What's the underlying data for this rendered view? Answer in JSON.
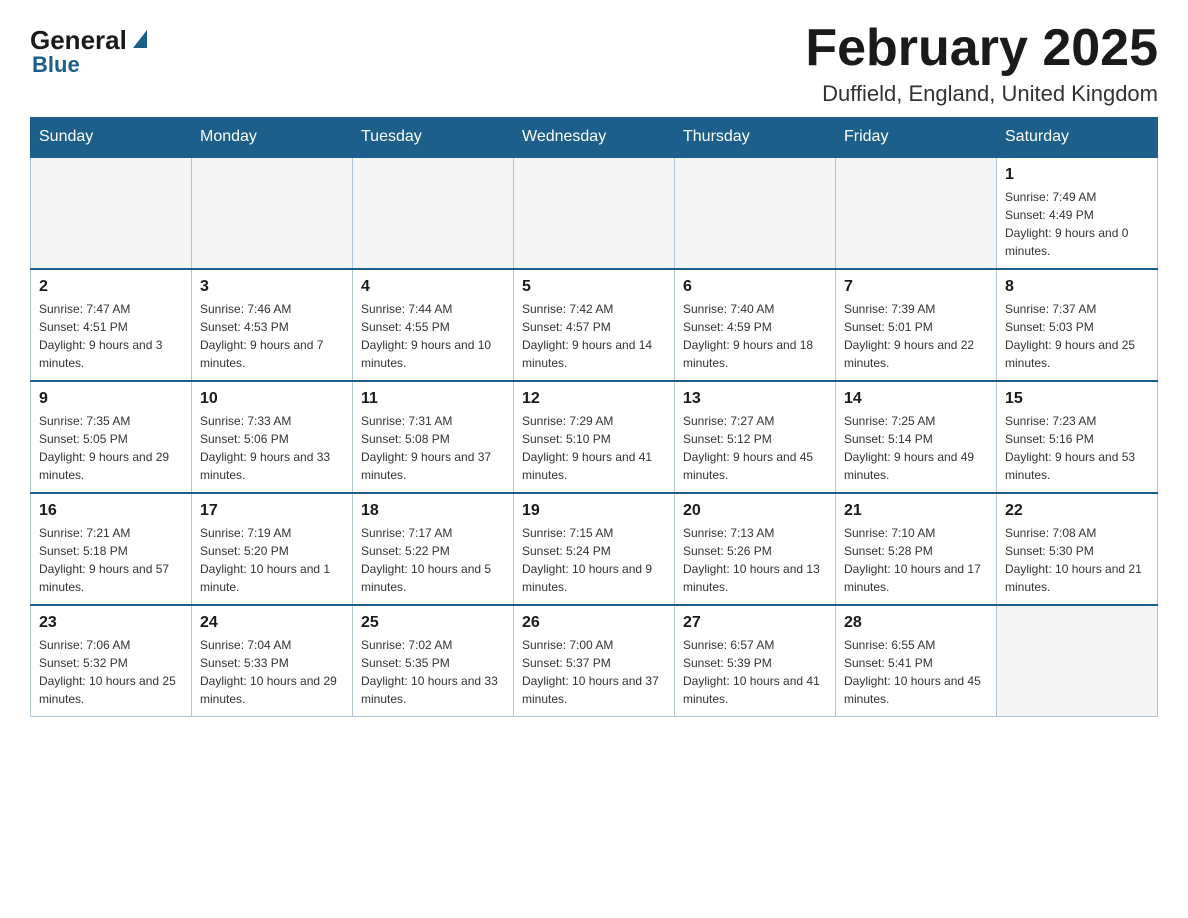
{
  "header": {
    "logo_general": "General",
    "logo_blue": "Blue",
    "month_title": "February 2025",
    "location": "Duffield, England, United Kingdom"
  },
  "days_of_week": [
    "Sunday",
    "Monday",
    "Tuesday",
    "Wednesday",
    "Thursday",
    "Friday",
    "Saturday"
  ],
  "weeks": [
    [
      {
        "num": "",
        "sunrise": "",
        "sunset": "",
        "daylight": "",
        "empty": true
      },
      {
        "num": "",
        "sunrise": "",
        "sunset": "",
        "daylight": "",
        "empty": true
      },
      {
        "num": "",
        "sunrise": "",
        "sunset": "",
        "daylight": "",
        "empty": true
      },
      {
        "num": "",
        "sunrise": "",
        "sunset": "",
        "daylight": "",
        "empty": true
      },
      {
        "num": "",
        "sunrise": "",
        "sunset": "",
        "daylight": "",
        "empty": true
      },
      {
        "num": "",
        "sunrise": "",
        "sunset": "",
        "daylight": "",
        "empty": true
      },
      {
        "num": "1",
        "sunrise": "Sunrise: 7:49 AM",
        "sunset": "Sunset: 4:49 PM",
        "daylight": "Daylight: 9 hours and 0 minutes.",
        "empty": false
      }
    ],
    [
      {
        "num": "2",
        "sunrise": "Sunrise: 7:47 AM",
        "sunset": "Sunset: 4:51 PM",
        "daylight": "Daylight: 9 hours and 3 minutes.",
        "empty": false
      },
      {
        "num": "3",
        "sunrise": "Sunrise: 7:46 AM",
        "sunset": "Sunset: 4:53 PM",
        "daylight": "Daylight: 9 hours and 7 minutes.",
        "empty": false
      },
      {
        "num": "4",
        "sunrise": "Sunrise: 7:44 AM",
        "sunset": "Sunset: 4:55 PM",
        "daylight": "Daylight: 9 hours and 10 minutes.",
        "empty": false
      },
      {
        "num": "5",
        "sunrise": "Sunrise: 7:42 AM",
        "sunset": "Sunset: 4:57 PM",
        "daylight": "Daylight: 9 hours and 14 minutes.",
        "empty": false
      },
      {
        "num": "6",
        "sunrise": "Sunrise: 7:40 AM",
        "sunset": "Sunset: 4:59 PM",
        "daylight": "Daylight: 9 hours and 18 minutes.",
        "empty": false
      },
      {
        "num": "7",
        "sunrise": "Sunrise: 7:39 AM",
        "sunset": "Sunset: 5:01 PM",
        "daylight": "Daylight: 9 hours and 22 minutes.",
        "empty": false
      },
      {
        "num": "8",
        "sunrise": "Sunrise: 7:37 AM",
        "sunset": "Sunset: 5:03 PM",
        "daylight": "Daylight: 9 hours and 25 minutes.",
        "empty": false
      }
    ],
    [
      {
        "num": "9",
        "sunrise": "Sunrise: 7:35 AM",
        "sunset": "Sunset: 5:05 PM",
        "daylight": "Daylight: 9 hours and 29 minutes.",
        "empty": false
      },
      {
        "num": "10",
        "sunrise": "Sunrise: 7:33 AM",
        "sunset": "Sunset: 5:06 PM",
        "daylight": "Daylight: 9 hours and 33 minutes.",
        "empty": false
      },
      {
        "num": "11",
        "sunrise": "Sunrise: 7:31 AM",
        "sunset": "Sunset: 5:08 PM",
        "daylight": "Daylight: 9 hours and 37 minutes.",
        "empty": false
      },
      {
        "num": "12",
        "sunrise": "Sunrise: 7:29 AM",
        "sunset": "Sunset: 5:10 PM",
        "daylight": "Daylight: 9 hours and 41 minutes.",
        "empty": false
      },
      {
        "num": "13",
        "sunrise": "Sunrise: 7:27 AM",
        "sunset": "Sunset: 5:12 PM",
        "daylight": "Daylight: 9 hours and 45 minutes.",
        "empty": false
      },
      {
        "num": "14",
        "sunrise": "Sunrise: 7:25 AM",
        "sunset": "Sunset: 5:14 PM",
        "daylight": "Daylight: 9 hours and 49 minutes.",
        "empty": false
      },
      {
        "num": "15",
        "sunrise": "Sunrise: 7:23 AM",
        "sunset": "Sunset: 5:16 PM",
        "daylight": "Daylight: 9 hours and 53 minutes.",
        "empty": false
      }
    ],
    [
      {
        "num": "16",
        "sunrise": "Sunrise: 7:21 AM",
        "sunset": "Sunset: 5:18 PM",
        "daylight": "Daylight: 9 hours and 57 minutes.",
        "empty": false
      },
      {
        "num": "17",
        "sunrise": "Sunrise: 7:19 AM",
        "sunset": "Sunset: 5:20 PM",
        "daylight": "Daylight: 10 hours and 1 minute.",
        "empty": false
      },
      {
        "num": "18",
        "sunrise": "Sunrise: 7:17 AM",
        "sunset": "Sunset: 5:22 PM",
        "daylight": "Daylight: 10 hours and 5 minutes.",
        "empty": false
      },
      {
        "num": "19",
        "sunrise": "Sunrise: 7:15 AM",
        "sunset": "Sunset: 5:24 PM",
        "daylight": "Daylight: 10 hours and 9 minutes.",
        "empty": false
      },
      {
        "num": "20",
        "sunrise": "Sunrise: 7:13 AM",
        "sunset": "Sunset: 5:26 PM",
        "daylight": "Daylight: 10 hours and 13 minutes.",
        "empty": false
      },
      {
        "num": "21",
        "sunrise": "Sunrise: 7:10 AM",
        "sunset": "Sunset: 5:28 PM",
        "daylight": "Daylight: 10 hours and 17 minutes.",
        "empty": false
      },
      {
        "num": "22",
        "sunrise": "Sunrise: 7:08 AM",
        "sunset": "Sunset: 5:30 PM",
        "daylight": "Daylight: 10 hours and 21 minutes.",
        "empty": false
      }
    ],
    [
      {
        "num": "23",
        "sunrise": "Sunrise: 7:06 AM",
        "sunset": "Sunset: 5:32 PM",
        "daylight": "Daylight: 10 hours and 25 minutes.",
        "empty": false
      },
      {
        "num": "24",
        "sunrise": "Sunrise: 7:04 AM",
        "sunset": "Sunset: 5:33 PM",
        "daylight": "Daylight: 10 hours and 29 minutes.",
        "empty": false
      },
      {
        "num": "25",
        "sunrise": "Sunrise: 7:02 AM",
        "sunset": "Sunset: 5:35 PM",
        "daylight": "Daylight: 10 hours and 33 minutes.",
        "empty": false
      },
      {
        "num": "26",
        "sunrise": "Sunrise: 7:00 AM",
        "sunset": "Sunset: 5:37 PM",
        "daylight": "Daylight: 10 hours and 37 minutes.",
        "empty": false
      },
      {
        "num": "27",
        "sunrise": "Sunrise: 6:57 AM",
        "sunset": "Sunset: 5:39 PM",
        "daylight": "Daylight: 10 hours and 41 minutes.",
        "empty": false
      },
      {
        "num": "28",
        "sunrise": "Sunrise: 6:55 AM",
        "sunset": "Sunset: 5:41 PM",
        "daylight": "Daylight: 10 hours and 45 minutes.",
        "empty": false
      },
      {
        "num": "",
        "sunrise": "",
        "sunset": "",
        "daylight": "",
        "empty": true
      }
    ]
  ]
}
